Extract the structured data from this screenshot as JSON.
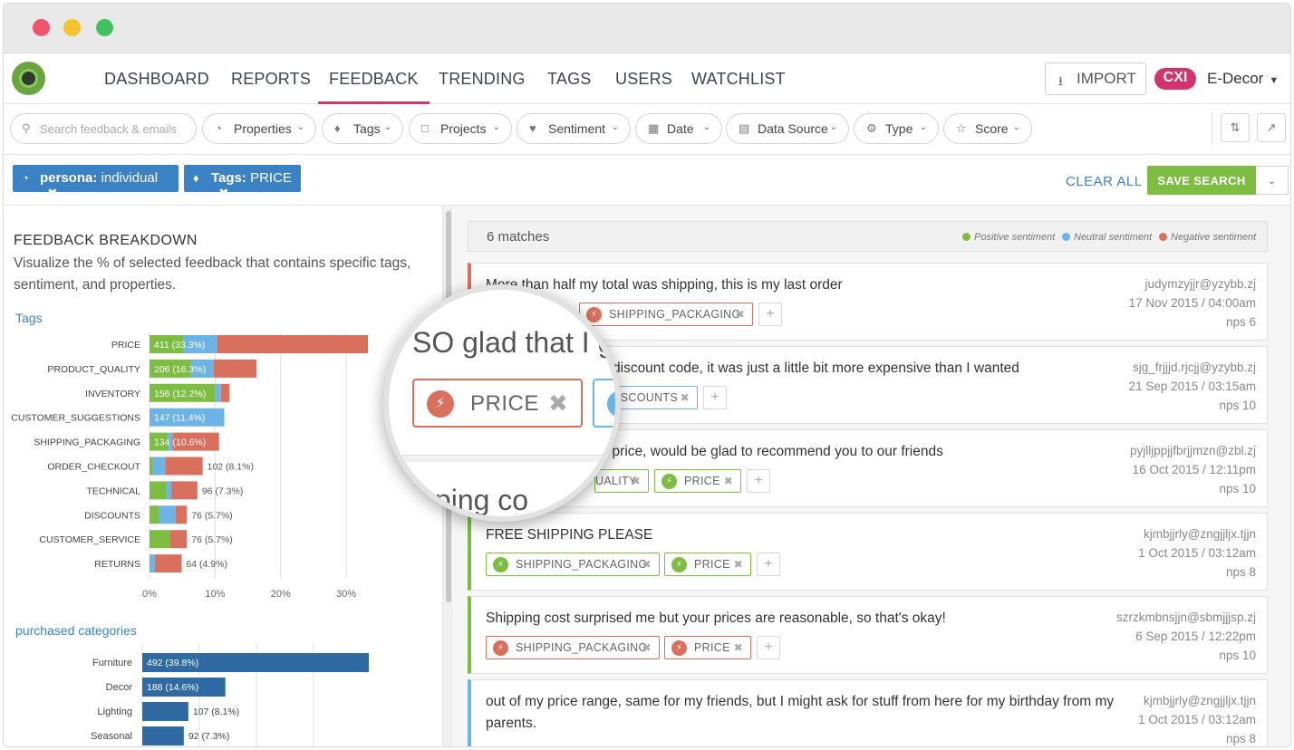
{
  "nav": {
    "items": [
      "DASHBOARD",
      "REPORTS",
      "FEEDBACK",
      "TRENDING",
      "TAGS",
      "USERS",
      "WATCHLIST"
    ],
    "active": "FEEDBACK",
    "import_label": "IMPORT",
    "badge": "CXI",
    "account": "E-Decor"
  },
  "filters": {
    "search_placeholder": "Search feedback & emails",
    "pills": [
      "Properties",
      "Tags",
      "Projects",
      "Sentiment",
      "Date",
      "Data Source",
      "Type",
      "Score"
    ]
  },
  "active_filters": [
    {
      "key": "persona:",
      "value": "individual"
    },
    {
      "key": "Tags:",
      "value": "PRICE"
    }
  ],
  "actions": {
    "clear_all": "CLEAR ALL",
    "save_search": "SAVE SEARCH"
  },
  "breakdown": {
    "title": "FEEDBACK BREAKDOWN",
    "description": "Visualize the % of selected feedback that contains specific tags, sentiment, and properties.",
    "tags_label": "Tags",
    "categories_label": "purchased categories"
  },
  "chart_data": [
    {
      "type": "bar",
      "orientation": "horizontal",
      "stacked": true,
      "title": "Tags",
      "categories": [
        "PRICE",
        "PRODUCT_QUALITY",
        "INVENTORY",
        "CUSTOMER_SUGGESTIONS",
        "SHIPPING_PACKAGING",
        "ORDER_CHECKOUT",
        "TECHNICAL",
        "DISCOUNTS",
        "CUSTOMER_SERVICE",
        "RETURNS"
      ],
      "labels": [
        "411 (33.3%)",
        "206 (16.3%)",
        "156 (12.2%)",
        "147 (11.4%)",
        "134 (10.6%)",
        "102 (8.1%)",
        "96 (7.3%)",
        "76 (5.7%)",
        "76 (5.7%)",
        "64 (4.9%)"
      ],
      "series": [
        {
          "name": "Positive sentiment",
          "color": "#7cbd42",
          "values": [
            5.2,
            6.3,
            10.0,
            0,
            2.8,
            0.5,
            2.5,
            1.5,
            3.1,
            0
          ]
        },
        {
          "name": "Neutral sentiment",
          "color": "#6cb3e6",
          "values": [
            5.1,
            3.5,
            0.9,
            11.4,
            0.7,
            1.9,
            0.8,
            2.5,
            0,
            0.8
          ]
        },
        {
          "name": "Negative sentiment",
          "color": "#d9705e",
          "values": [
            23.0,
            6.5,
            1.3,
            0,
            7.1,
            5.7,
            4.0,
            1.7,
            2.6,
            4.1
          ]
        }
      ],
      "xticks": [
        "0%",
        "10%",
        "20%",
        "30%"
      ],
      "xlim": [
        0,
        33.3
      ]
    },
    {
      "type": "bar",
      "orientation": "horizontal",
      "title": "purchased categories",
      "categories": [
        "Furniture",
        "Decor",
        "Lighting",
        "Seasonal"
      ],
      "values": [
        39.8,
        14.6,
        8.1,
        7.3
      ],
      "labels": [
        "492 (39.8%)",
        "188 (14.6%)",
        "107 (8.1%)",
        "92 (7.3%)"
      ],
      "color": "#2f6aa3",
      "xlim": [
        0,
        39.8
      ]
    }
  ],
  "results": {
    "count": "6 matches",
    "legend": [
      {
        "label": "Positive sentiment",
        "color": "#7cbd42"
      },
      {
        "label": "Neutral sentiment",
        "color": "#6cb3e6"
      },
      {
        "label": "Negative sentiment",
        "color": "#d9705e"
      }
    ],
    "items": [
      {
        "text": "More than half my total was shipping, this is my last order",
        "email": "judymzyjjr@yzybb.zj",
        "date": "17 Nov 2015 / 04:00am",
        "nps": "nps 6"
      },
      {
        "text": "discount code, it was just a little bit more expensive than I wanted",
        "email": "sjg_frjjjd.rjcjj@yzybb.zj",
        "date": "21 Sep 2015 / 03:15am",
        "nps": "nps 10"
      },
      {
        "text": "he price, would be glad to recommend you to our friends",
        "email": "pyjlljppjjfbrjjmzn@zbl.zj",
        "date": "16 Oct 2015 / 12:11pm",
        "nps": "nps 10"
      },
      {
        "text": "FREE SHIPPING PLEASE",
        "email": "kjmbjjrly@zngjjljx.tjjn",
        "date": "1 Oct 2015 / 03:12am",
        "nps": "nps 8"
      },
      {
        "text": "Shipping cost surprised me but your prices are reasonable, so that's okay!",
        "email": "szrzkmbnsjjn@sbmjjjsp.zj",
        "date": "6 Sep 2015 / 12:22pm",
        "nps": "nps 10"
      },
      {
        "text": "out of my price range, same for my friends, but I might ask for stuff from here for my birthday from my parents.",
        "email": "kjmbjjrly@zngjjljx.tjjn",
        "date": "1 Oct 2015 / 03:12am",
        "nps": "nps 8"
      }
    ],
    "tags": {
      "shipping_packaging": "SHIPPING_PACKAGING",
      "price": "PRICE",
      "discounts": "ISCOUNTS",
      "quality_partial": "UALITY"
    }
  },
  "magnifier": {
    "line1": "SO glad that I g",
    "tag": "PRICE",
    "line2": "ipping co"
  }
}
